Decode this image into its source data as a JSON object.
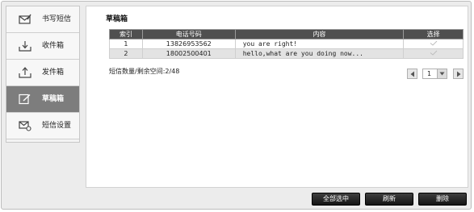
{
  "sidebar": {
    "items": [
      {
        "label": "书写短信",
        "icon": "compose-mail-icon"
      },
      {
        "label": "收件箱",
        "icon": "inbox-icon"
      },
      {
        "label": "发件箱",
        "icon": "outbox-icon"
      },
      {
        "label": "草稿箱",
        "icon": "drafts-icon",
        "active": true
      },
      {
        "label": "短信设置",
        "icon": "sms-settings-icon"
      }
    ]
  },
  "main": {
    "title": "草稿箱",
    "table": {
      "headers": [
        "索引",
        "电话号码",
        "内容",
        "选择"
      ],
      "rows": [
        {
          "index": "1",
          "phone": "13826953562",
          "content": "you are right!",
          "checked": false
        },
        {
          "index": "2",
          "phone": "18002500401",
          "content": "hello,what are you doing now...",
          "checked": false
        }
      ]
    },
    "count_text": "短信数量/剩余空间:2/48",
    "pager": {
      "current": "1"
    }
  },
  "buttons": {
    "select_all": "全部选中",
    "refresh": "刷新",
    "delete": "删除"
  },
  "colors": {
    "active_sidebar": "#7d7d7d",
    "table_header": "#4f4f4f",
    "button_bg": "#1e1e1e"
  }
}
